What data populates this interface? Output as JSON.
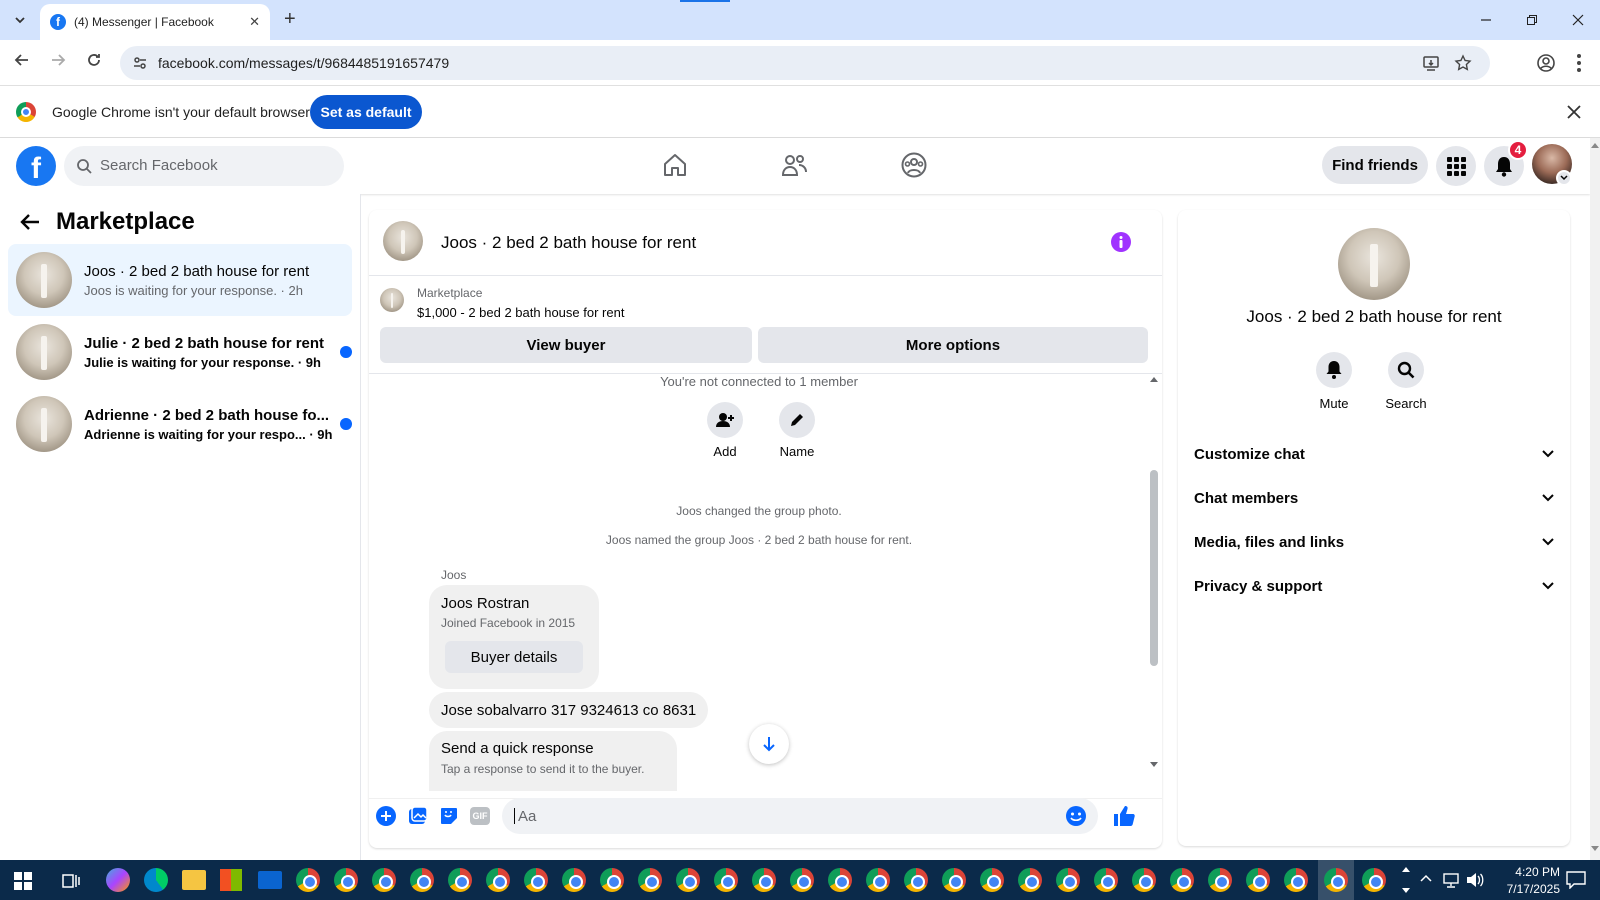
{
  "browser": {
    "tab_title": "(4) Messenger | Facebook",
    "url": "facebook.com/messages/t/9684485191657479",
    "tab_favicon": "f",
    "new_tab": "+",
    "close_tab": "✕"
  },
  "banner": {
    "text": "Google Chrome isn't your default browser",
    "button": "Set as default"
  },
  "fb_header": {
    "logo": "f",
    "search_placeholder": "Search Facebook",
    "find_friends": "Find friends",
    "notifications_count": "4"
  },
  "left": {
    "title": "Marketplace",
    "conversations": [
      {
        "name": "Joos · 2 bed 2 bath house for rent",
        "preview": "Joos is waiting for your response. · 2h",
        "unread": false,
        "selected": true
      },
      {
        "name": "Julie · 2 bed 2 bath house for rent",
        "preview": "Julie is waiting for your response. · 9h",
        "unread": true,
        "selected": false
      },
      {
        "name": "Adrienne · 2 bed 2 bath house fo...",
        "preview": "Adrienne is waiting for your respo... · 9h",
        "unread": true,
        "selected": false
      }
    ]
  },
  "thread": {
    "title": "Joos · 2 bed 2 bath house for rent",
    "listing_source": "Marketplace",
    "listing_title": "$1,000 - 2 bed 2 bath house for rent",
    "view_buyer": "View buyer",
    "more_options": "More options",
    "not_connected": "You're not connected to 1 member",
    "add_label": "Add",
    "name_label": "Name",
    "event1": "Joos changed the group photo.",
    "event2": "Joos named the group Joos · 2 bed 2 bath house for rent.",
    "sender": "Joos",
    "card_name": "Joos Rostran",
    "card_sub": "Joined Facebook in 2015",
    "card_button": "Buyer details",
    "message": "Jose sobalvarro 317 9324613 co 8631",
    "quick_title": "Send a quick response",
    "quick_sub": "Tap a response to send it to the buyer.",
    "composer_placeholder": "Aa",
    "gif_label": "GIF"
  },
  "details": {
    "name": "Joos · 2 bed 2 bath house for rent",
    "mute": "Mute",
    "search": "Search",
    "sections": [
      "Customize chat",
      "Chat members",
      "Media, files and links",
      "Privacy & support"
    ]
  },
  "taskbar": {
    "time": "4:20 PM",
    "date": "7/17/2025"
  },
  "colors": {
    "fb_blue": "#1877f2",
    "purple_accent": "#a033ff",
    "selected_row": "#ebf5ff",
    "notification_red": "#e41e3f"
  }
}
